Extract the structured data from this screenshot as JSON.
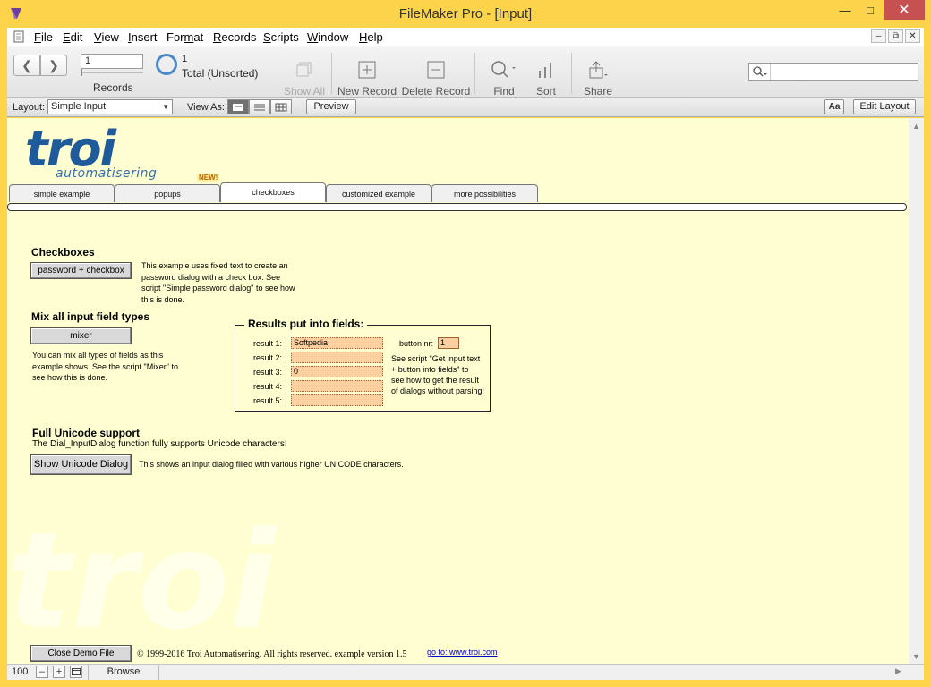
{
  "window": {
    "title": "FileMaker Pro - [Input]"
  },
  "menu": [
    {
      "label": "File",
      "u": "F",
      "rest": "ile"
    },
    {
      "label": "Edit",
      "u": "E",
      "rest": "dit"
    },
    {
      "label": "View",
      "u": "V",
      "rest": "iew"
    },
    {
      "label": "Insert",
      "u": "I",
      "rest": "nsert"
    },
    {
      "label": "Format",
      "pre": "For",
      "u": "m",
      "rest": "at"
    },
    {
      "label": "Records",
      "u": "R",
      "rest": "ecords"
    },
    {
      "label": "Scripts",
      "u": "S",
      "rest": "cripts"
    },
    {
      "label": "Window",
      "u": "W",
      "rest": "indow"
    },
    {
      "label": "Help",
      "u": "H",
      "rest": "elp"
    }
  ],
  "toolbar": {
    "record_current": "1",
    "records_label": "Records",
    "found_count": "1",
    "found_total": "Total (Unsorted)",
    "show_all": "Show All",
    "new_record": "New Record",
    "delete_record": "Delete Record",
    "find": "Find",
    "sort": "Sort",
    "share": "Share",
    "quickfind_value": ""
  },
  "layoutbar": {
    "layout_label": "Layout:",
    "layout_value": "Simple Input",
    "view_as_label": "View As:",
    "preview": "Preview",
    "aa": "Aa",
    "edit_layout": "Edit Layout"
  },
  "content": {
    "logo_main": "troi",
    "logo_sub": "automatisering",
    "new_badge": "NEW!",
    "tabs": [
      "simple example",
      "popups",
      "checkboxes",
      "customized example",
      "more possibilities"
    ],
    "active_tab": "checkboxes",
    "checkboxes": {
      "title": "Checkboxes",
      "button": "password + checkbox",
      "desc": [
        "This example uses fixed text to create an",
        "password dialog with a check box. See",
        "script \"Simple password dialog\"  to see how",
        "this is done."
      ]
    },
    "mix": {
      "title": "Mix all input field types",
      "button": "mixer",
      "desc": [
        "You can mix all types of fields as this",
        "example shows. See the script \"Mixer\"  to",
        "see how this is done."
      ]
    },
    "results": {
      "title": "Results put into fields:",
      "rows": [
        {
          "label": "result 1:",
          "value": "Softpedia"
        },
        {
          "label": "result 2:",
          "value": ""
        },
        {
          "label": "result 3:",
          "value": "0"
        },
        {
          "label": "result 4:",
          "value": ""
        },
        {
          "label": "result 5:",
          "value": ""
        }
      ],
      "button_nr_label": "button nr:",
      "button_nr_value": "1",
      "note": [
        "See script \"Get input text",
        "+ button into fields\"  to",
        "see how to get the result",
        "of dialogs without parsing!"
      ]
    },
    "unicode": {
      "title": "Full Unicode support",
      "subtitle": "The Dial_InputDialog function fully supports Unicode characters!",
      "button": "Show Unicode Dialog",
      "desc": "This shows an input dialog filled with various higher UNICODE characters."
    },
    "watermark": "troi",
    "footer": {
      "close_button": "Close Demo File",
      "copyright": "© 1999-2016 Troi Automatisering.  All rights reserved. example version 1.5",
      "link": "go to: www.troi.com"
    }
  },
  "statusbar": {
    "zoom": "100",
    "mode": "Browse"
  },
  "colors": {
    "accent": "#1f5a9b",
    "content_bg": "#ffffd1",
    "field_bg": "#ffcfa0",
    "titlebar": "#fbd44c"
  }
}
